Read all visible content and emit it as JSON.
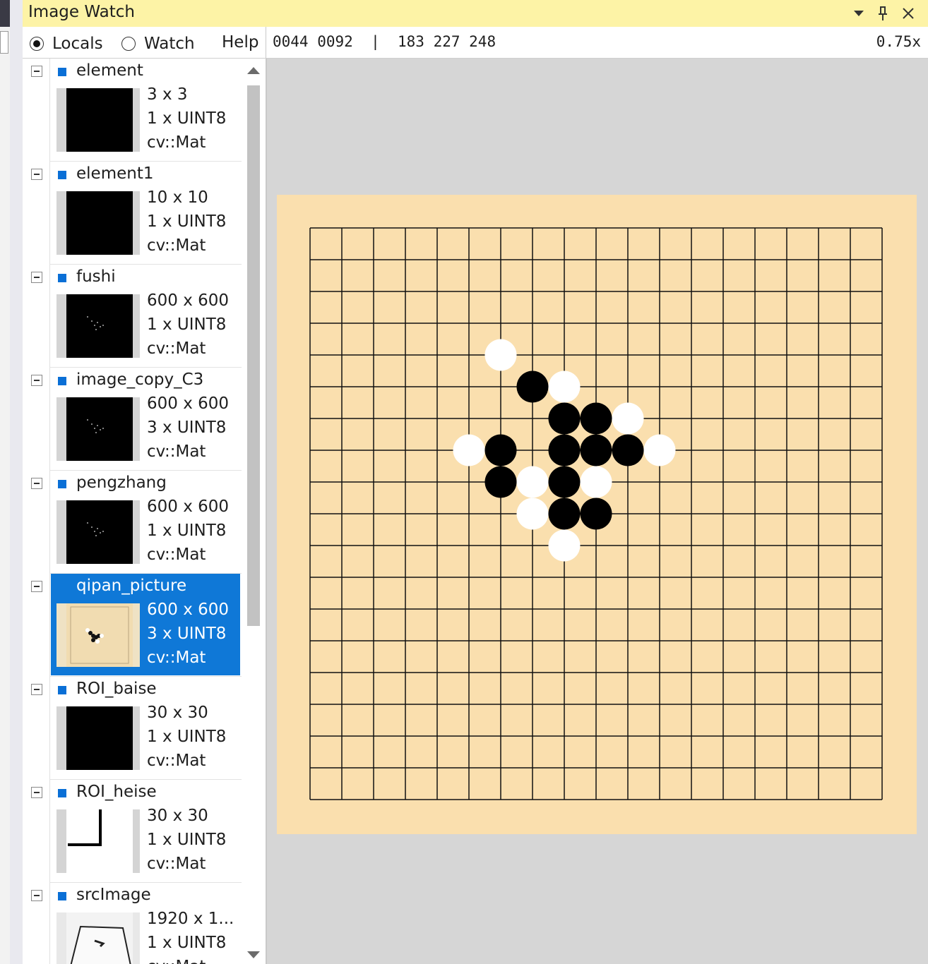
{
  "window": {
    "title": "Image Watch"
  },
  "toolbar": {
    "locals_label": "Locals",
    "watch_label": "Watch",
    "help_label": "Help",
    "selected_mode": "Locals",
    "pixel_coords": "0044 0092",
    "pixel_value": "183 227 248",
    "zoom": "0.75x"
  },
  "list": {
    "items": [
      {
        "name": "element",
        "size": "3 x 3",
        "channels": "1 x UINT8",
        "type": "cv::Mat"
      },
      {
        "name": "element1",
        "size": "10 x 10",
        "channels": "1 x UINT8",
        "type": "cv::Mat"
      },
      {
        "name": "fushi",
        "size": "600 x 600",
        "channels": "1 x UINT8",
        "type": "cv::Mat"
      },
      {
        "name": "image_copy_C3",
        "size": "600 x 600",
        "channels": "3 x UINT8",
        "type": "cv::Mat"
      },
      {
        "name": "pengzhang",
        "size": "600 x 600",
        "channels": "1 x UINT8",
        "type": "cv::Mat"
      },
      {
        "name": "qipan_picture",
        "size": "600 x 600",
        "channels": "3 x UINT8",
        "type": "cv::Mat"
      },
      {
        "name": "ROI_baise",
        "size": "30 x 30",
        "channels": "1 x UINT8",
        "type": "cv::Mat"
      },
      {
        "name": "ROI_heise",
        "size": "30 x 30",
        "channels": "1 x UINT8",
        "type": "cv::Mat"
      },
      {
        "name": "srcImage",
        "size": "1920 x 1...",
        "channels": "1 x UINT8",
        "type": "cv::Mat"
      }
    ],
    "selected": "qipan_picture"
  },
  "colors": {
    "title_bar": "#fdf3a6",
    "selection": "#0f78d7",
    "board": "#fadfae",
    "accent_square": "#0a6fd6"
  },
  "board": {
    "grid_lines": 19,
    "black_stones": [
      [
        5,
        7
      ],
      [
        6,
        8
      ],
      [
        6,
        9
      ],
      [
        7,
        9
      ],
      [
        7,
        8
      ],
      [
        7,
        10
      ],
      [
        7,
        6
      ],
      [
        8,
        6
      ],
      [
        8,
        8
      ],
      [
        9,
        8
      ],
      [
        9,
        9
      ]
    ],
    "white_stones": [
      [
        4,
        6
      ],
      [
        5,
        8
      ],
      [
        6,
        10
      ],
      [
        7,
        5
      ],
      [
        7,
        11
      ],
      [
        8,
        7
      ],
      [
        8,
        9
      ],
      [
        9,
        7
      ],
      [
        10,
        8
      ]
    ]
  }
}
